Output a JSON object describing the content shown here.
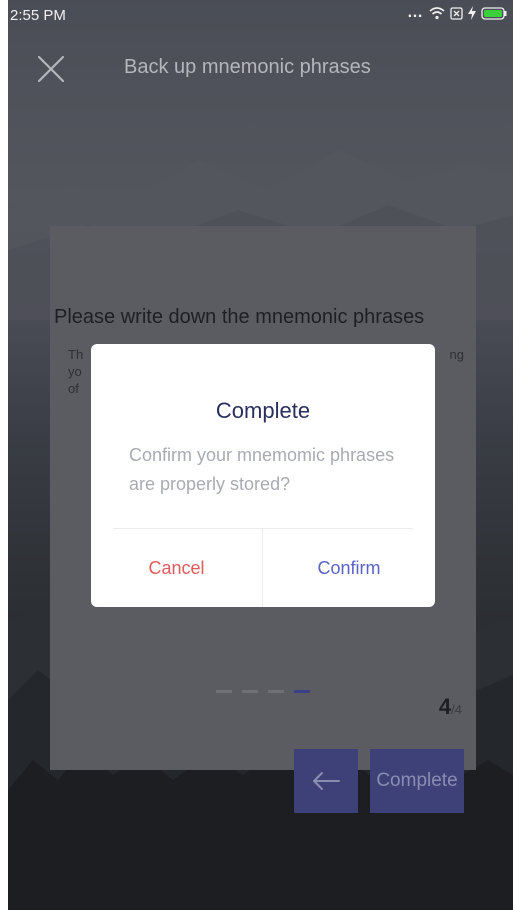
{
  "status_bar": {
    "time": "2:55 PM",
    "icons": [
      "more-dots-icon",
      "wifi-icon",
      "sim-icon",
      "charging-icon",
      "battery-icon"
    ]
  },
  "header": {
    "close_icon": "close-icon",
    "title": "Back up mnemonic phrases"
  },
  "card": {
    "title": "Please write down the mnemonic phrases",
    "description_left": "Th\nyo\nof",
    "description_right": "ng",
    "pager": {
      "total_dots": 4,
      "active_dot": 4,
      "current": "4",
      "total": "/4"
    }
  },
  "nav": {
    "back_icon": "arrow-left-icon",
    "complete_label": "Complete"
  },
  "dialog": {
    "title": "Complete",
    "message": "Confirm your mnemomic phrases are properly stored?",
    "cancel_label": "Cancel",
    "confirm_label": "Confirm"
  },
  "colors": {
    "accent": "#3e4178",
    "cancel": "#e05a5a",
    "confirm": "#5a63c6",
    "dialog_title": "#2b2f5e"
  }
}
